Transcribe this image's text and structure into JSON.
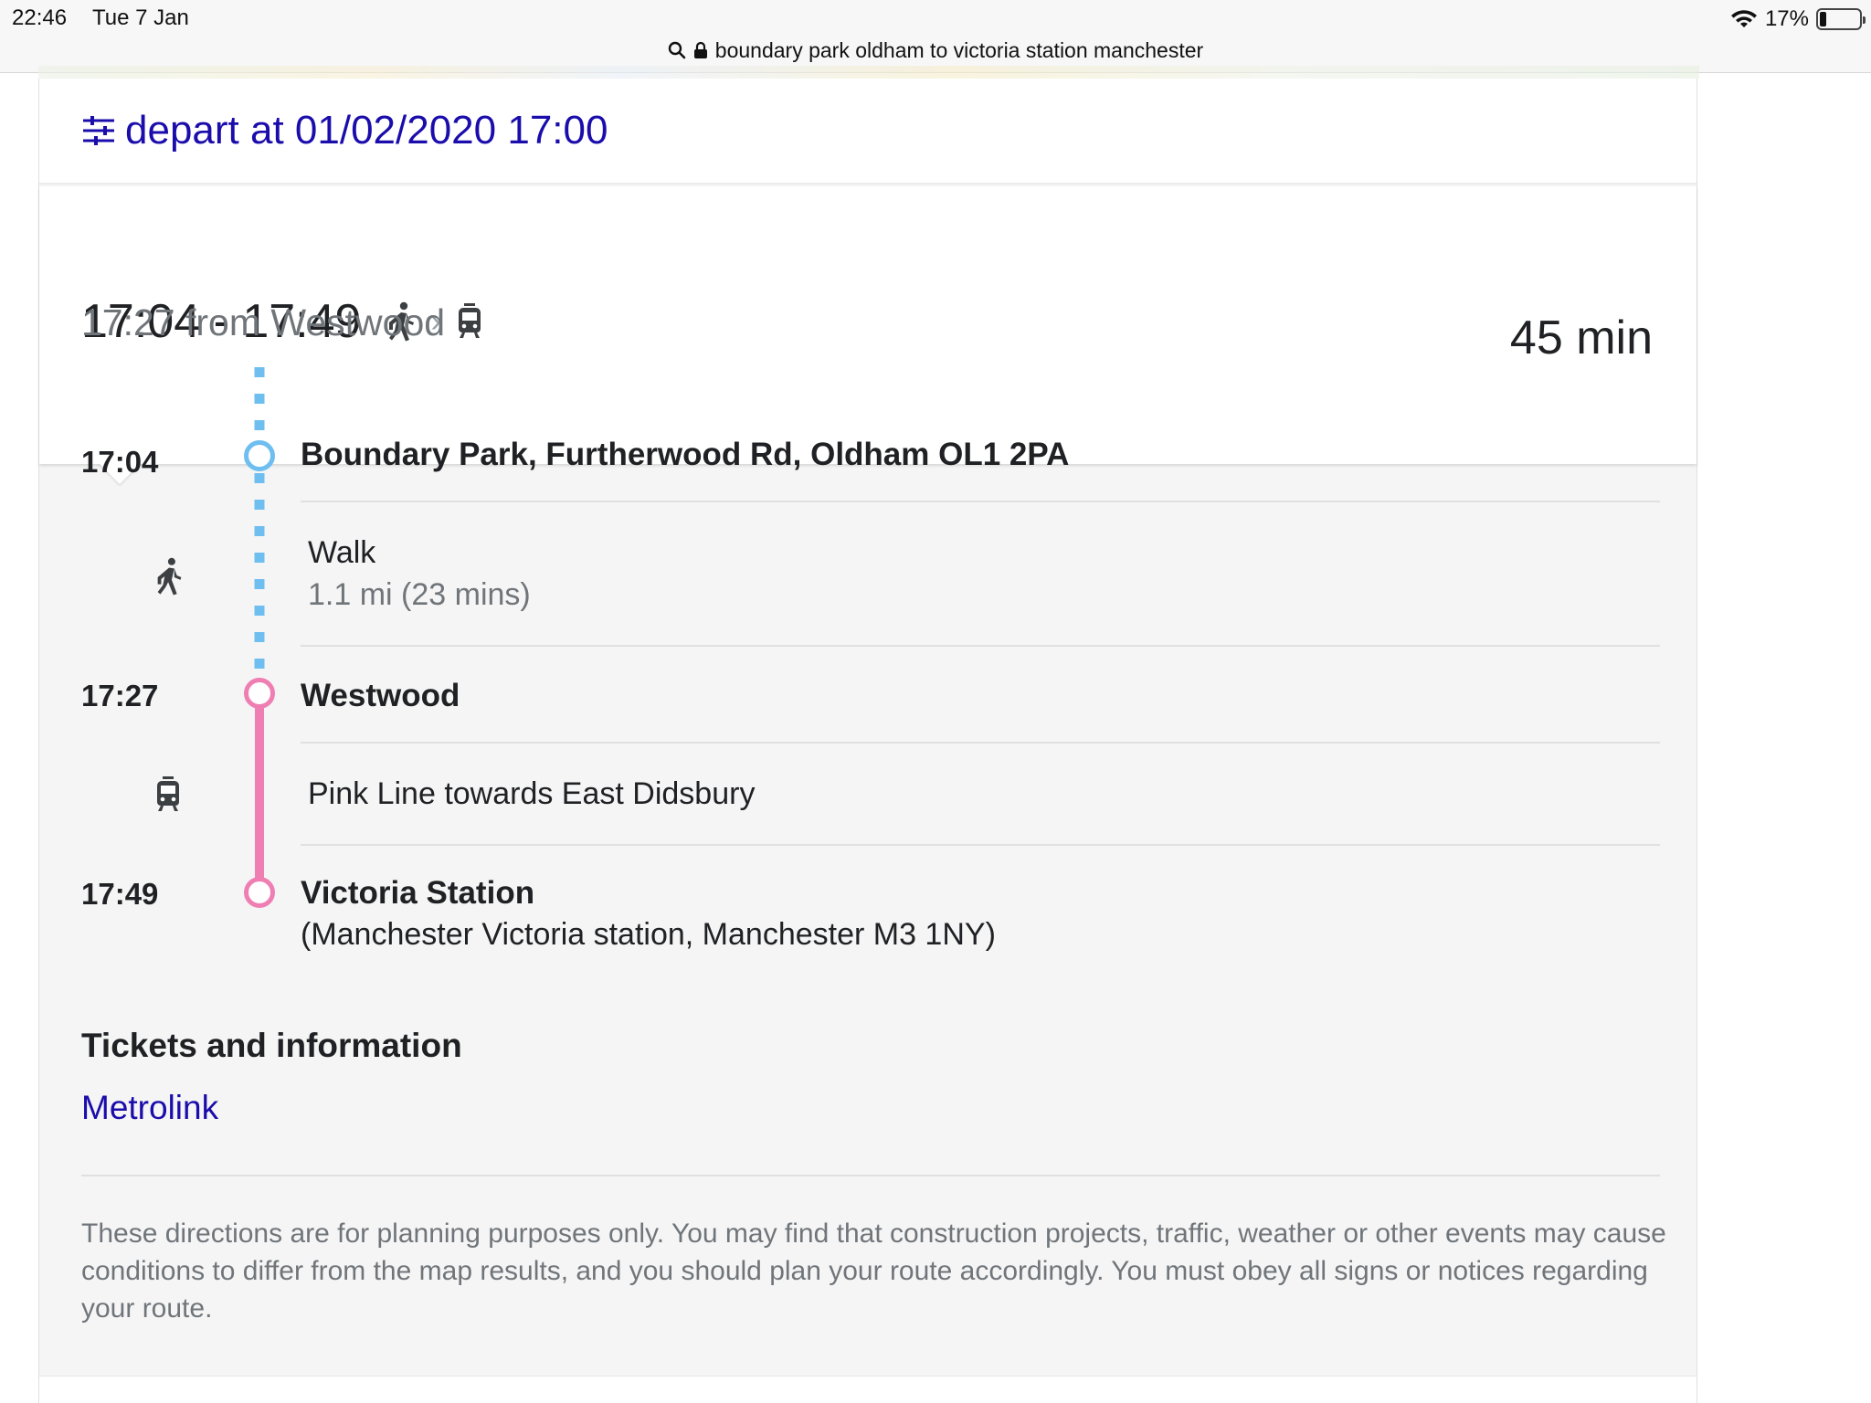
{
  "status_bar": {
    "time": "22:46",
    "date": "Tue 7 Jan",
    "battery_text": "17%",
    "battery_level": 0.17
  },
  "url_bar": {
    "query": "boundary park oldham to victoria station manchester"
  },
  "options": {
    "depart_label": "depart at 01/02/2020 17:00"
  },
  "summary": {
    "time_range": "17:04 - 17:49",
    "from_text": "17:27 from Westwood",
    "duration": "45 min"
  },
  "steps": {
    "origin_time": "17:04",
    "origin_name": "Boundary Park, Furtherwood Rd, Oldham OL1 2PA",
    "walk_label": "Walk",
    "walk_detail": "1.1 mi (23 mins)",
    "transfer_time": "17:27",
    "transfer_name": "Westwood",
    "tram_label": "Pink Line towards East Didsbury",
    "dest_time": "17:49",
    "dest_name": "Victoria Station",
    "dest_address": "(Manchester Victoria station, Manchester M3 1NY)"
  },
  "tickets": {
    "heading": "Tickets and information",
    "link": "Metrolink"
  },
  "disclaimer": "These directions are for planning purposes only. You may find that construction projects, traffic, weather or other events may cause conditions to differ from the map results, and you should plan your route accordingly. You must obey all signs or notices regarding your route.",
  "colors": {
    "link": "#1a0dab",
    "walk_line": "#6ebef0",
    "pink_line": "#ef7fb3",
    "muted_text": "#70757a"
  },
  "icons": {
    "options": "sliders-icon",
    "walk": "walking-person-icon",
    "tram": "tram-icon",
    "search": "search-icon",
    "lock": "lock-icon",
    "wifi": "wifi-icon",
    "battery": "battery-icon"
  }
}
